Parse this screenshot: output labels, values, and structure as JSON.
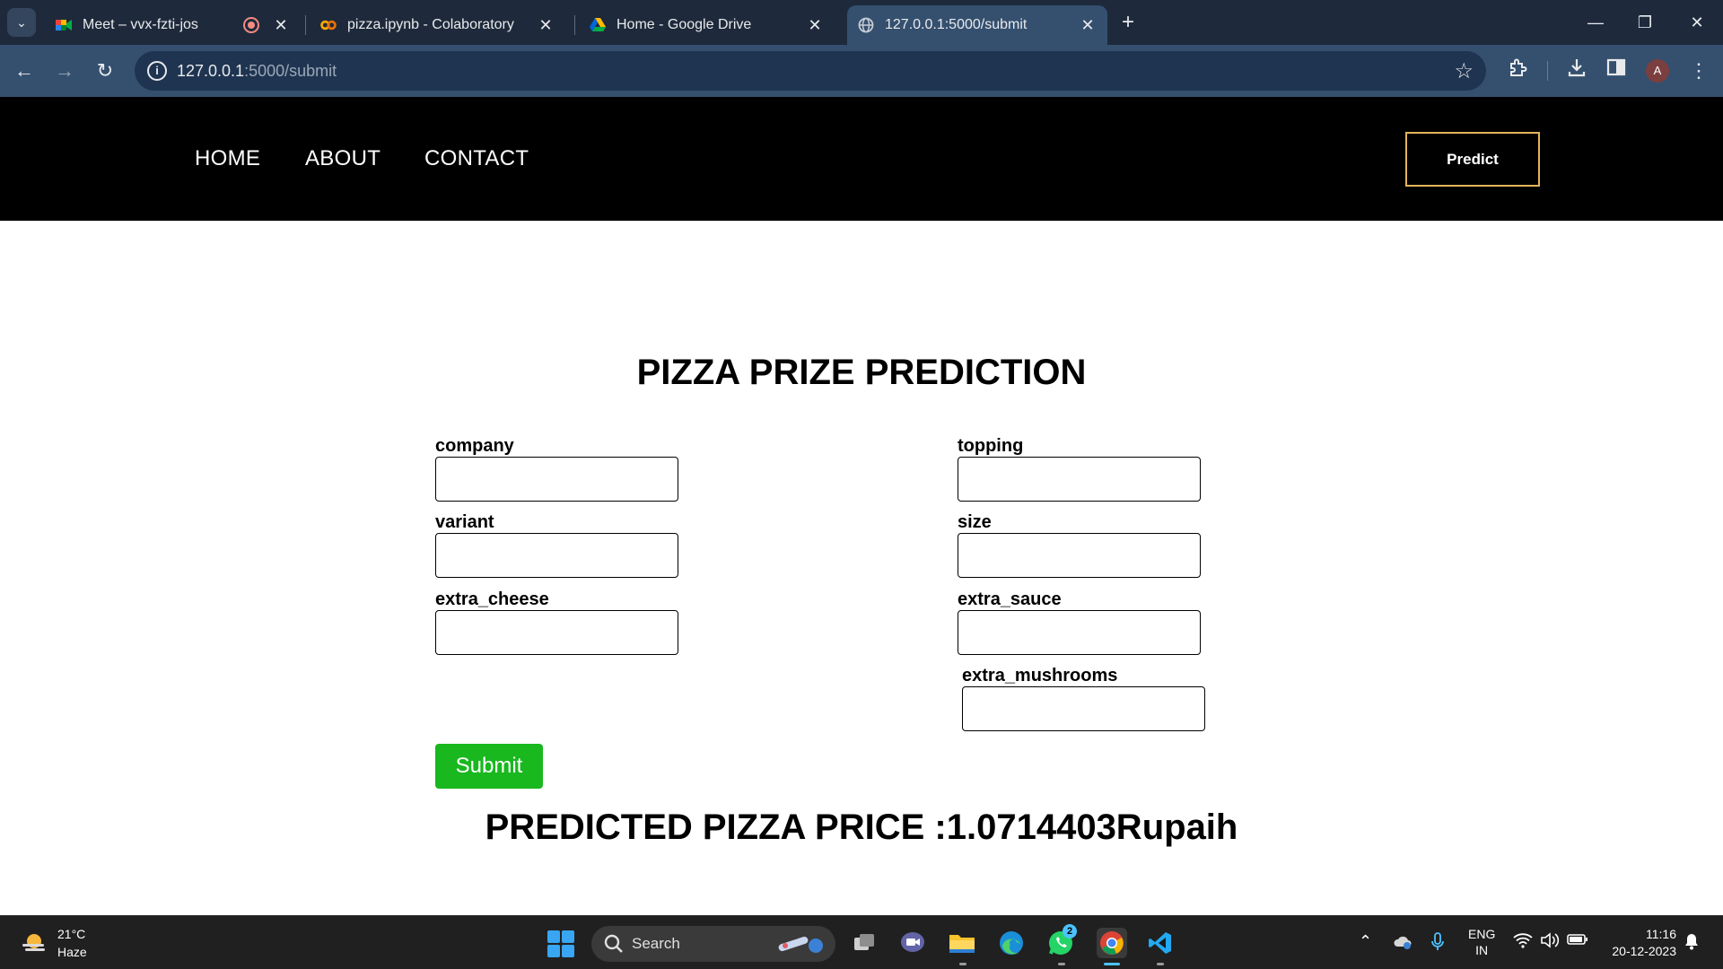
{
  "browser": {
    "tabs": [
      {
        "title": "Meet – vvx-fzti-jos",
        "icon": "google-meet-icon"
      },
      {
        "title": "pizza.ipynb - Colaboratory",
        "icon": "colab-icon"
      },
      {
        "title": "Home - Google Drive",
        "icon": "google-drive-icon"
      },
      {
        "title": "127.0.0.1:5000/submit",
        "icon": "globe-icon"
      }
    ],
    "active_tab": 3,
    "url_host": "127.0.0.1",
    "url_path": ":5000/submit",
    "profile_initial": "A"
  },
  "site_nav": {
    "links": [
      "HOME",
      "ABOUT",
      "CONTACT"
    ],
    "predict_label": "Predict",
    "accent": "#e3b45a"
  },
  "main": {
    "title": "PIZZA PRIZE PREDICTION",
    "fields": {
      "company": "company",
      "topping": "topping",
      "variant": "variant",
      "size": "size",
      "extra_cheese": "extra_cheese",
      "extra_sauce": "extra_sauce",
      "extra_mushrooms": "extra_mushrooms"
    },
    "submit_label": "Submit",
    "submit_color": "#18b81e",
    "result": "PREDICTED PIZZA PRICE :1.0714403Rupaih"
  },
  "taskbar": {
    "weather_temp": "21°C",
    "weather_condition": "Haze",
    "search_label": "Search",
    "whatsapp_badge": "2",
    "lang_line1": "ENG",
    "lang_line2": "IN",
    "time": "11:16",
    "date": "20-12-2023"
  }
}
